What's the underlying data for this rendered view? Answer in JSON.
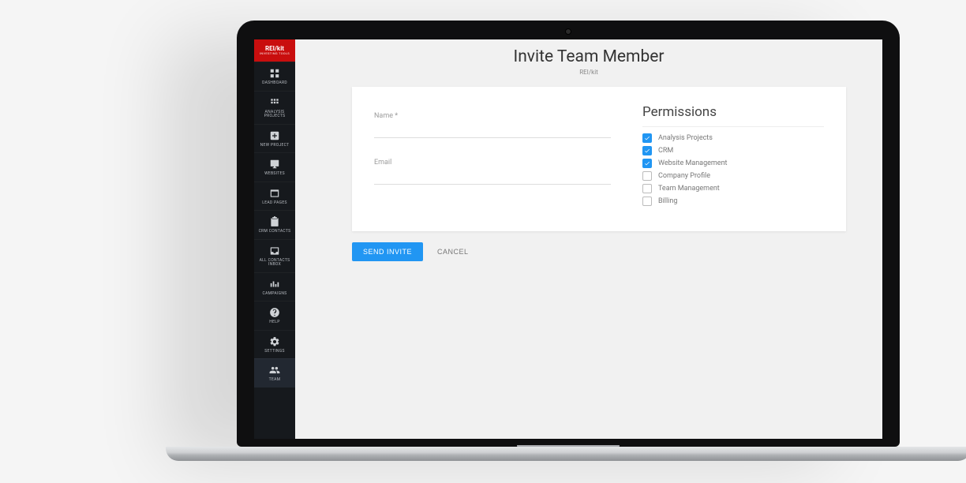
{
  "brand": {
    "name": "REI/kit",
    "tagline": "INVESTING TOOLS"
  },
  "sidebar": {
    "items": [
      {
        "label": "DASHBOARD",
        "icon": "grid"
      },
      {
        "label": "ANALYSIS PROJECTS",
        "icon": "apps"
      },
      {
        "label": "NEW PROJECT",
        "icon": "plus-box"
      },
      {
        "label": "WEBSITES",
        "icon": "monitor"
      },
      {
        "label": "LEAD PAGES",
        "icon": "window"
      },
      {
        "label": "CRM CONTACTS",
        "icon": "clipboard"
      },
      {
        "label": "ALL CONTACTS INBOX",
        "icon": "inbox"
      },
      {
        "label": "CAMPAIGNS",
        "icon": "campaign"
      },
      {
        "label": "HELP",
        "icon": "help"
      },
      {
        "label": "SETTINGS",
        "icon": "gear"
      },
      {
        "label": "TEAM",
        "icon": "team"
      }
    ]
  },
  "header": {
    "title": "Invite Team Member",
    "subtitle": "REI/kit"
  },
  "form": {
    "name_label": "Name *",
    "name_value": "",
    "email_label": "Email",
    "email_value": ""
  },
  "permissions": {
    "title": "Permissions",
    "items": [
      {
        "label": "Analysis Projects",
        "checked": true
      },
      {
        "label": "CRM",
        "checked": true
      },
      {
        "label": "Website Management",
        "checked": true
      },
      {
        "label": "Company Profile",
        "checked": false
      },
      {
        "label": "Team Management",
        "checked": false
      },
      {
        "label": "Billing",
        "checked": false
      }
    ]
  },
  "actions": {
    "primary": "SEND INVITE",
    "secondary": "CANCEL"
  }
}
